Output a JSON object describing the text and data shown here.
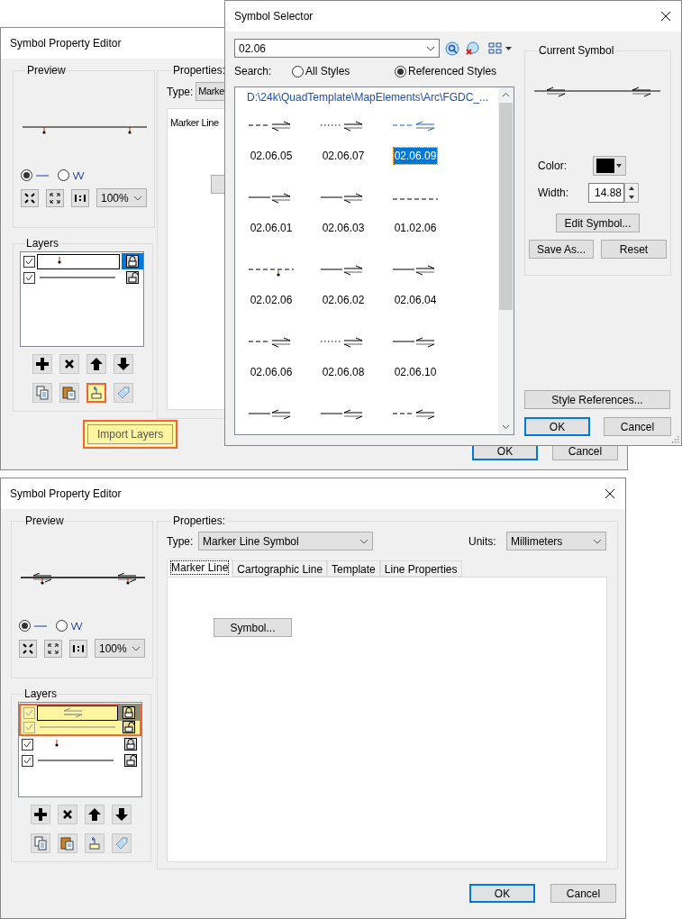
{
  "background_dialog": {
    "title": "Symbol Property Editor",
    "preview": {
      "title": "Preview",
      "styles": [
        {
          "kind": "line",
          "selected": true
        },
        {
          "kind": "zigzag",
          "selected": false
        }
      ],
      "zoom": "100%"
    },
    "layers": {
      "title": "Layers",
      "focused": true,
      "items": [
        {
          "kind": "marker",
          "checked": true,
          "selected": true,
          "locked": true,
          "highlighted": false
        },
        {
          "kind": "line",
          "checked": true,
          "selected": false,
          "locked": false,
          "highlighted": false
        }
      ],
      "tools": [
        {
          "kind": "add",
          "highlighted": false
        },
        {
          "kind": "delete",
          "highlighted": false
        },
        {
          "kind": "up",
          "highlighted": false
        },
        {
          "kind": "down",
          "highlighted": false
        },
        {
          "kind": "copy",
          "highlighted": false
        },
        {
          "kind": "paste",
          "highlighted": false
        },
        {
          "kind": "import",
          "highlighted": true
        },
        {
          "kind": "tag",
          "highlighted": false
        }
      ]
    },
    "properties": {
      "title": "Properties:",
      "type_label": "Type:",
      "type_value": "Marke",
      "tabs": [
        {
          "label": "Marker Line",
          "selected": true
        }
      ]
    },
    "tooltip": "Import Layers",
    "buttons": [
      {
        "label": "OK",
        "default": true
      },
      {
        "label": "Cancel",
        "default": false
      }
    ]
  },
  "symbol_selector": {
    "title": "Symbol Selector",
    "search_value": "02.06",
    "search_label": "Search:",
    "scopes": [
      {
        "label": "All Styles",
        "selected": false
      },
      {
        "label": "Referenced Styles",
        "selected": true
      }
    ],
    "style_path": "D:\\24k\\QuadTemplate\\MapElements\\Arc\\FGDC_...",
    "symbols": [
      {
        "label": "02.06.05",
        "kind": "dashright",
        "selected": false
      },
      {
        "label": "02.06.07",
        "kind": "dotright",
        "selected": false
      },
      {
        "label": "02.06.09",
        "kind": "dashleft",
        "selected": true
      },
      {
        "label": "02.06.01",
        "kind": "solidright",
        "selected": false
      },
      {
        "label": "02.06.03",
        "kind": "solidright",
        "selected": false
      },
      {
        "label": "01.02.06",
        "kind": "dashed",
        "selected": false
      },
      {
        "label": "02.02.06",
        "kind": "dashmarker",
        "selected": false
      },
      {
        "label": "02.06.02",
        "kind": "solidright",
        "selected": false
      },
      {
        "label": "02.06.04",
        "kind": "solidright",
        "selected": false
      },
      {
        "label": "02.06.06",
        "kind": "dashright",
        "selected": false
      },
      {
        "label": "02.06.08",
        "kind": "dotright",
        "selected": false
      },
      {
        "label": "02.06.10",
        "kind": "solidleft",
        "selected": false
      },
      {
        "kind": "solidleft",
        "selected": false
      },
      {
        "kind": "solidleft",
        "selected": false
      },
      {
        "kind": "dashleft",
        "selected": false
      }
    ],
    "current_symbol": {
      "title": "Current Symbol",
      "color_label": "Color:",
      "color": "#000000",
      "width_label": "Width:",
      "width_value": "14.88",
      "edit_button": "Edit Symbol...",
      "save_button": "Save As...",
      "reset_button": "Reset"
    },
    "style_references_button": "Style References...",
    "buttons": [
      {
        "label": "OK",
        "default": true
      },
      {
        "label": "Cancel",
        "default": false
      }
    ]
  },
  "symbol_property_editor": {
    "title": "Symbol Property Editor",
    "preview": {
      "title": "Preview",
      "styles": [
        {
          "kind": "line",
          "selected": true
        },
        {
          "kind": "zigzag",
          "selected": false
        }
      ],
      "zoom": "100%"
    },
    "layers": {
      "title": "Layers",
      "focused": false,
      "items": [
        {
          "kind": "arrows",
          "checked": true,
          "selected": true,
          "locked": true,
          "highlighted": true
        },
        {
          "kind": "line",
          "checked": true,
          "selected": false,
          "locked": false,
          "highlighted": true
        },
        {
          "kind": "marker",
          "checked": true,
          "selected": false,
          "locked": true,
          "highlighted": false
        },
        {
          "kind": "line",
          "checked": true,
          "selected": false,
          "locked": false,
          "highlighted": false
        }
      ],
      "tools": [
        {
          "kind": "add",
          "highlighted": false
        },
        {
          "kind": "delete",
          "highlighted": false
        },
        {
          "kind": "up",
          "highlighted": false
        },
        {
          "kind": "down",
          "highlighted": false
        },
        {
          "kind": "copy",
          "highlighted": false
        },
        {
          "kind": "paste",
          "highlighted": false
        },
        {
          "kind": "import",
          "highlighted": false
        },
        {
          "kind": "tag",
          "highlighted": false
        }
      ]
    },
    "properties": {
      "title": "Properties:",
      "type_label": "Type:",
      "type_value": "Marker Line Symbol",
      "units_label": "Units:",
      "units_value": "Millimeters",
      "tabs": [
        {
          "label": "Marker Line",
          "selected": true
        },
        {
          "label": "Cartographic Line",
          "selected": false
        },
        {
          "label": "Template",
          "selected": false
        },
        {
          "label": "Line Properties",
          "selected": false
        }
      ],
      "symbol_button": "Symbol..."
    },
    "buttons": [
      {
        "label": "OK",
        "default": true
      },
      {
        "label": "Cancel",
        "default": false
      }
    ]
  }
}
